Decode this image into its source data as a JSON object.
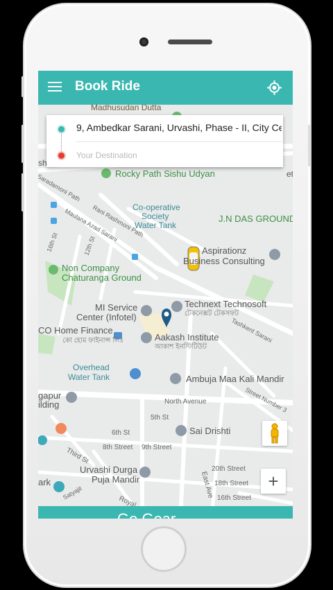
{
  "header": {
    "title": "Book Ride",
    "menu_icon": "hamburger-menu-icon",
    "locate_icon": "gps-locate-icon"
  },
  "booking": {
    "pickup": "9, Ambedkar Sarani, Urvashi, Phase - II, City Ce",
    "destination_placeholder": "Your Destination"
  },
  "map": {
    "labels": {
      "madhusudan": "Madhusudan Dutta",
      "rocky": "Rocky Path Sishu Udyan",
      "saradamoni": "Saradamoni Path",
      "maulana": "Maulana Azad Sarani",
      "rani": "Rani Rashmoni Path",
      "coop1": "Co-operative",
      "coop2": "Society",
      "coop3": "Water Tank",
      "jndas": "J.N DAS GROUND",
      "aspir1": "Aspirationz",
      "aspir2": "Business Consulting",
      "noncompany1": "Non Company",
      "noncompany2": "Chaturanga Ground",
      "mi1": "MI Service",
      "mi2": "Center (Infotel)",
      "technext": "Technext Technosoft",
      "technext_bn": "টেকনেক্সট টেকসফট",
      "co_home": "CO Home Finance",
      "co_home_bn": "কো হোম ফাইনান্স লিঃ",
      "aakash": "Aakash Institute",
      "aakash_bn": "আকাশ ইনস্টিটিউট",
      "tashkent": "Tashkent Sarani",
      "overhead1": "Overhead",
      "overhead2": "Water Tank",
      "ambuja": "Ambuja Maa Kali Mandir",
      "gapur": "gapur",
      "ilding": "ilding",
      "north_ave": "North Avenue",
      "street3": "Street Number 3",
      "fifth": "5th St",
      "sixth": "6th St",
      "sai": "Sai Drishti",
      "third": "Third St",
      "eighth": "8th Street",
      "ninth": "9th Street",
      "urvashi1": "Urvashi Durga",
      "urvashi2": "Puja Mandir",
      "east_ave": "East Ave",
      "twentieth": "20th Street",
      "eighteenth": "18th Street",
      "sixteenth": "16th Street",
      "ark": "ark",
      "satyajit": "Satyajit",
      "royal": "Royal",
      "sixteenth_st": "16th St",
      "twelfth": "12th St",
      "et": "et",
      "sh": "sh"
    }
  },
  "controls": {
    "zoom_in": "+",
    "pegman_icon": "street-view-pegman-icon"
  },
  "bottom": {
    "label": "Go Gear"
  },
  "colors": {
    "accent": "#3bb7b1",
    "destination": "#e53b2f"
  }
}
